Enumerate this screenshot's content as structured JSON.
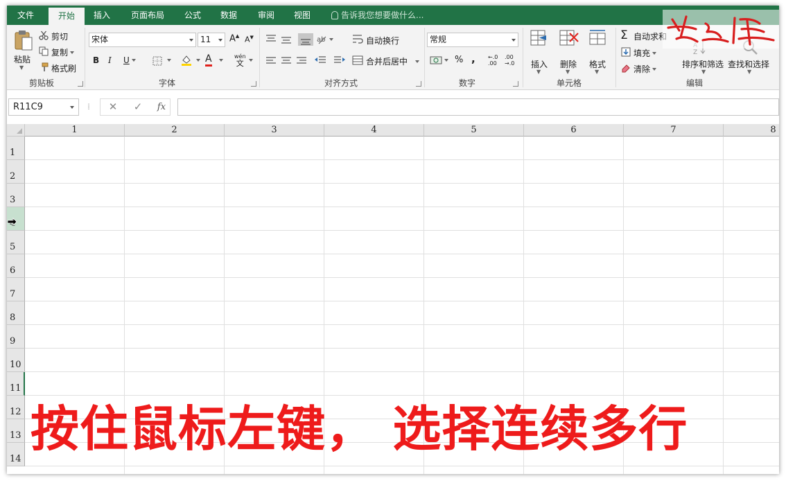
{
  "menu": {
    "tabs": [
      {
        "label": "文件"
      },
      {
        "label": "开始",
        "active": true
      },
      {
        "label": "插入"
      },
      {
        "label": "页面布局"
      },
      {
        "label": "公式"
      },
      {
        "label": "数据"
      },
      {
        "label": "审阅"
      },
      {
        "label": "视图"
      }
    ],
    "tell_me": "告诉我您想要做什么..."
  },
  "ribbon": {
    "clipboard": {
      "paste": "粘贴",
      "cut": "剪切",
      "copy": "复制",
      "format_painter": "格式刷",
      "label": "剪贴板"
    },
    "font": {
      "name": "宋体",
      "size": "11",
      "bold": "B",
      "italic": "I",
      "underline": "U",
      "grow": "A",
      "shrink": "A",
      "phonetic_top": "wén",
      "phonetic_bottom": "文",
      "font_color_letter": "A",
      "label": "字体"
    },
    "alignment": {
      "wrap": "自动换行",
      "merge": "合并后居中",
      "label": "对齐方式"
    },
    "number": {
      "format": "常规",
      "percent": "%",
      "comma": ",",
      "inc_top": "←.0",
      "inc_bottom": ".00",
      "dec_top": ".00",
      "dec_bottom": "→.0",
      "label": "数字"
    },
    "cells": {
      "insert": "插入",
      "delete": "删除",
      "format": "格式",
      "label": "单元格"
    },
    "editing": {
      "autosum": "自动求和",
      "fill": "填充",
      "clear": "清除",
      "sort": "排序和筛选",
      "find": "查找和选择",
      "label": "编辑"
    }
  },
  "formula_bar": {
    "name_box": "R11C9",
    "cancel": "✕",
    "enter": "✓",
    "fx": "fx",
    "value": ""
  },
  "sheet": {
    "columns": [
      "1",
      "2",
      "3",
      "4",
      "5",
      "6",
      "7",
      "8"
    ],
    "rows": [
      "1",
      "2",
      "3",
      "4",
      "5",
      "6",
      "7",
      "8",
      "9",
      "10",
      "11",
      "12",
      "13",
      "14"
    ],
    "highlighted_row": "4",
    "active_row": "11"
  },
  "overlay": {
    "caption": "按住鼠标左键， 选择连续多行",
    "watermark": "兰之峰"
  },
  "colors": {
    "brand": "#217346",
    "caption": "#ee1b1b",
    "row_highlight": "#c7e0cf"
  }
}
